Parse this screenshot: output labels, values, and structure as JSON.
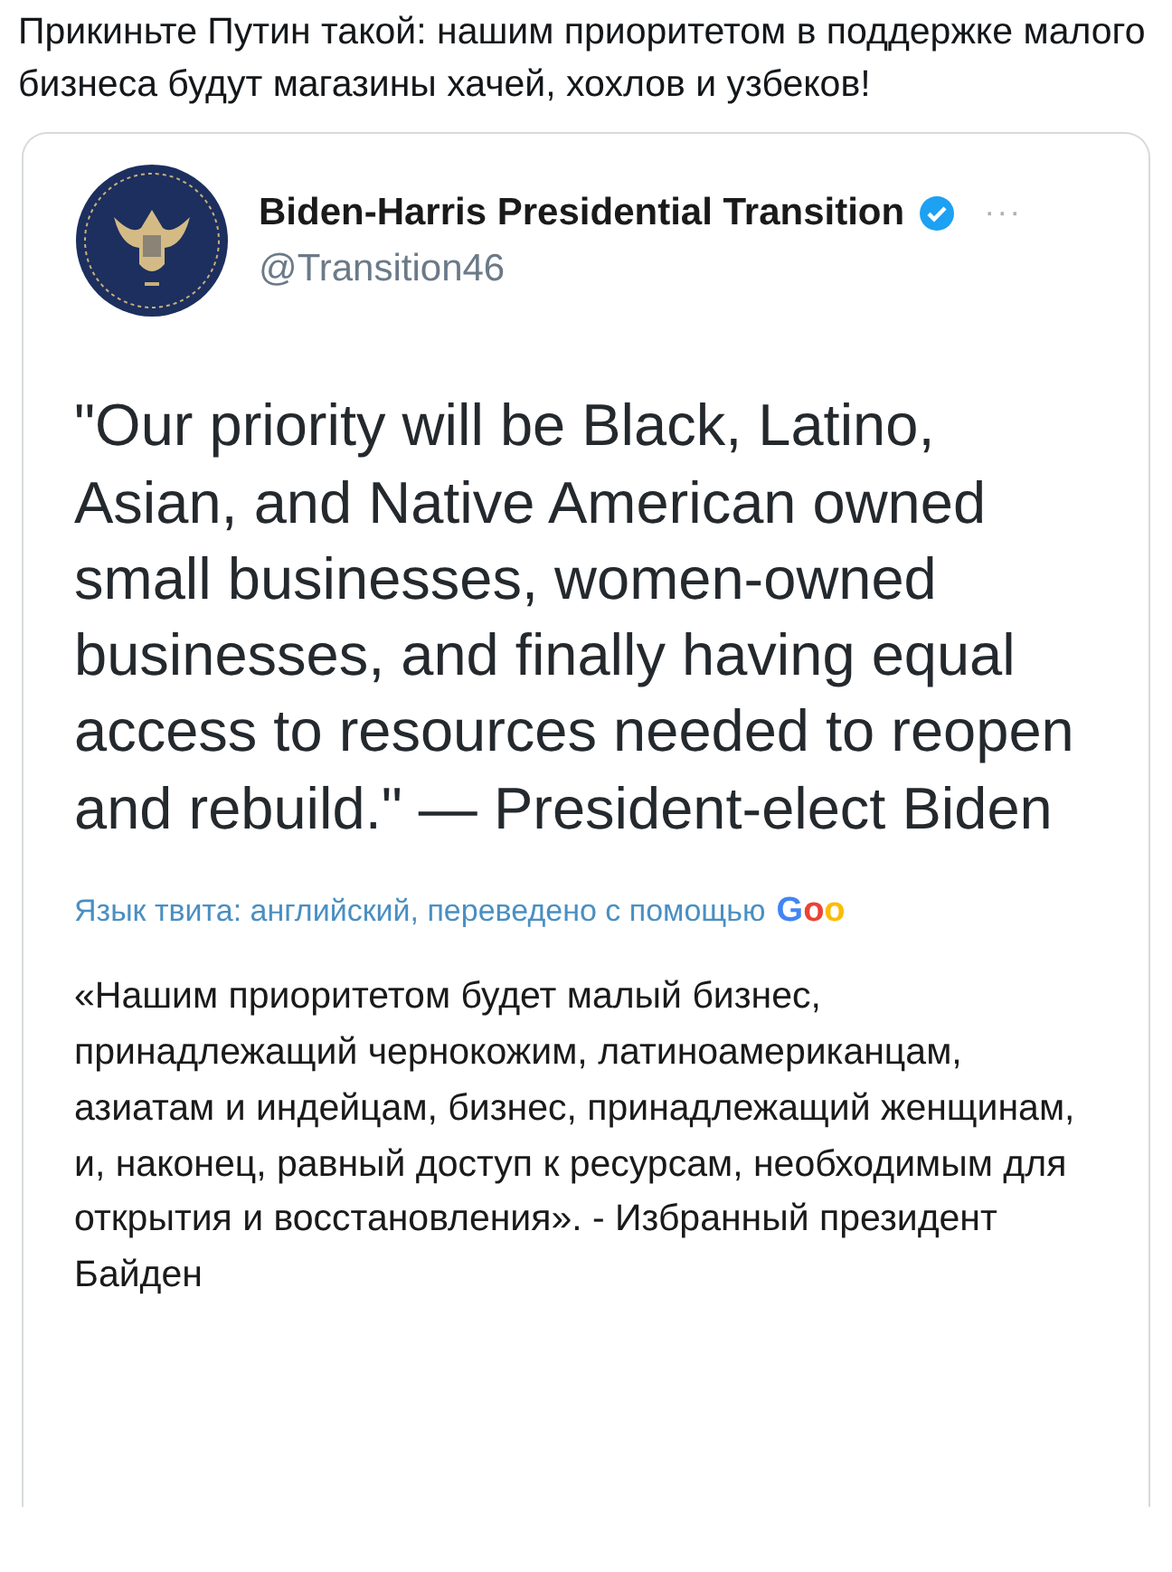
{
  "post_text": "Прикиньте Путин такой: нашим приоритетом в поддержке малого бизнеса будут магазины хачей, хохлов и узбеков!",
  "quoted_tweet": {
    "author_name": "Biden-Harris Presidential Transition",
    "verified": true,
    "handle": "@Transition46",
    "more": "···",
    "text": "\"Our priority will be Black, Latino, Asian, and Native American owned small businesses, women-owned businesses, and finally having equal access to resources needed to reopen and rebuild.\" — President-elect Biden",
    "translation_note": "Язык твита: английский, переведено с помощью",
    "translator_logo": "Goo",
    "translation": "«Нашим приоритетом будет малый бизнес, принадлежащий чернокожим, латиноамериканцам, азиатам и индейцам, бизнес, принадлежащий женщинам, и, наконец, равный доступ к ресурсам, необходимым для открытия и восстановления». - Избранный президент Байден"
  }
}
